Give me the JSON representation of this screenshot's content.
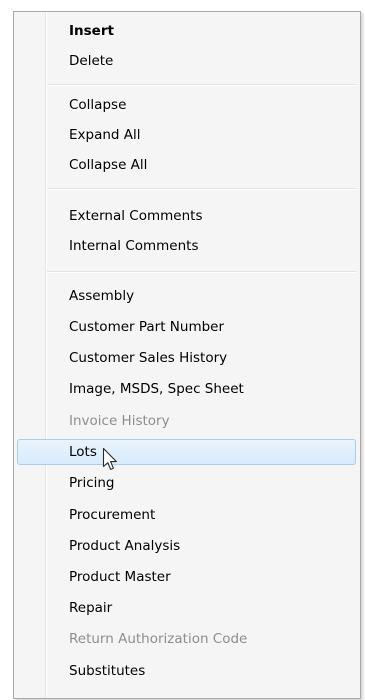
{
  "menu": {
    "items": [
      {
        "label": "Insert"
      },
      {
        "label": "Delete"
      },
      {
        "label": "Collapse"
      },
      {
        "label": "Expand All"
      },
      {
        "label": "Collapse All"
      },
      {
        "label": "External Comments"
      },
      {
        "label": "Internal Comments"
      },
      {
        "label": "Assembly"
      },
      {
        "label": "Customer Part Number"
      },
      {
        "label": "Customer Sales History"
      },
      {
        "label": "Image, MSDS, Spec Sheet"
      },
      {
        "label": "Invoice History",
        "state": "disabled"
      },
      {
        "label": "Lots",
        "state": "highlighted"
      },
      {
        "label": "Pricing"
      },
      {
        "label": "Procurement"
      },
      {
        "label": "Product Analysis"
      },
      {
        "label": "Product Master"
      },
      {
        "label": "Repair"
      },
      {
        "label": "Return Authorization Code",
        "state": "disabled"
      },
      {
        "label": "Substitutes"
      }
    ],
    "default_item": "Insert"
  },
  "colors": {
    "background": "#f5f5f5",
    "highlight_fill": "#dcecfc",
    "highlight_border": "#a7cdf0",
    "disabled_text": "#8d8d8d"
  },
  "icons": {
    "cursor": "mouse-pointer-arrow-icon"
  }
}
